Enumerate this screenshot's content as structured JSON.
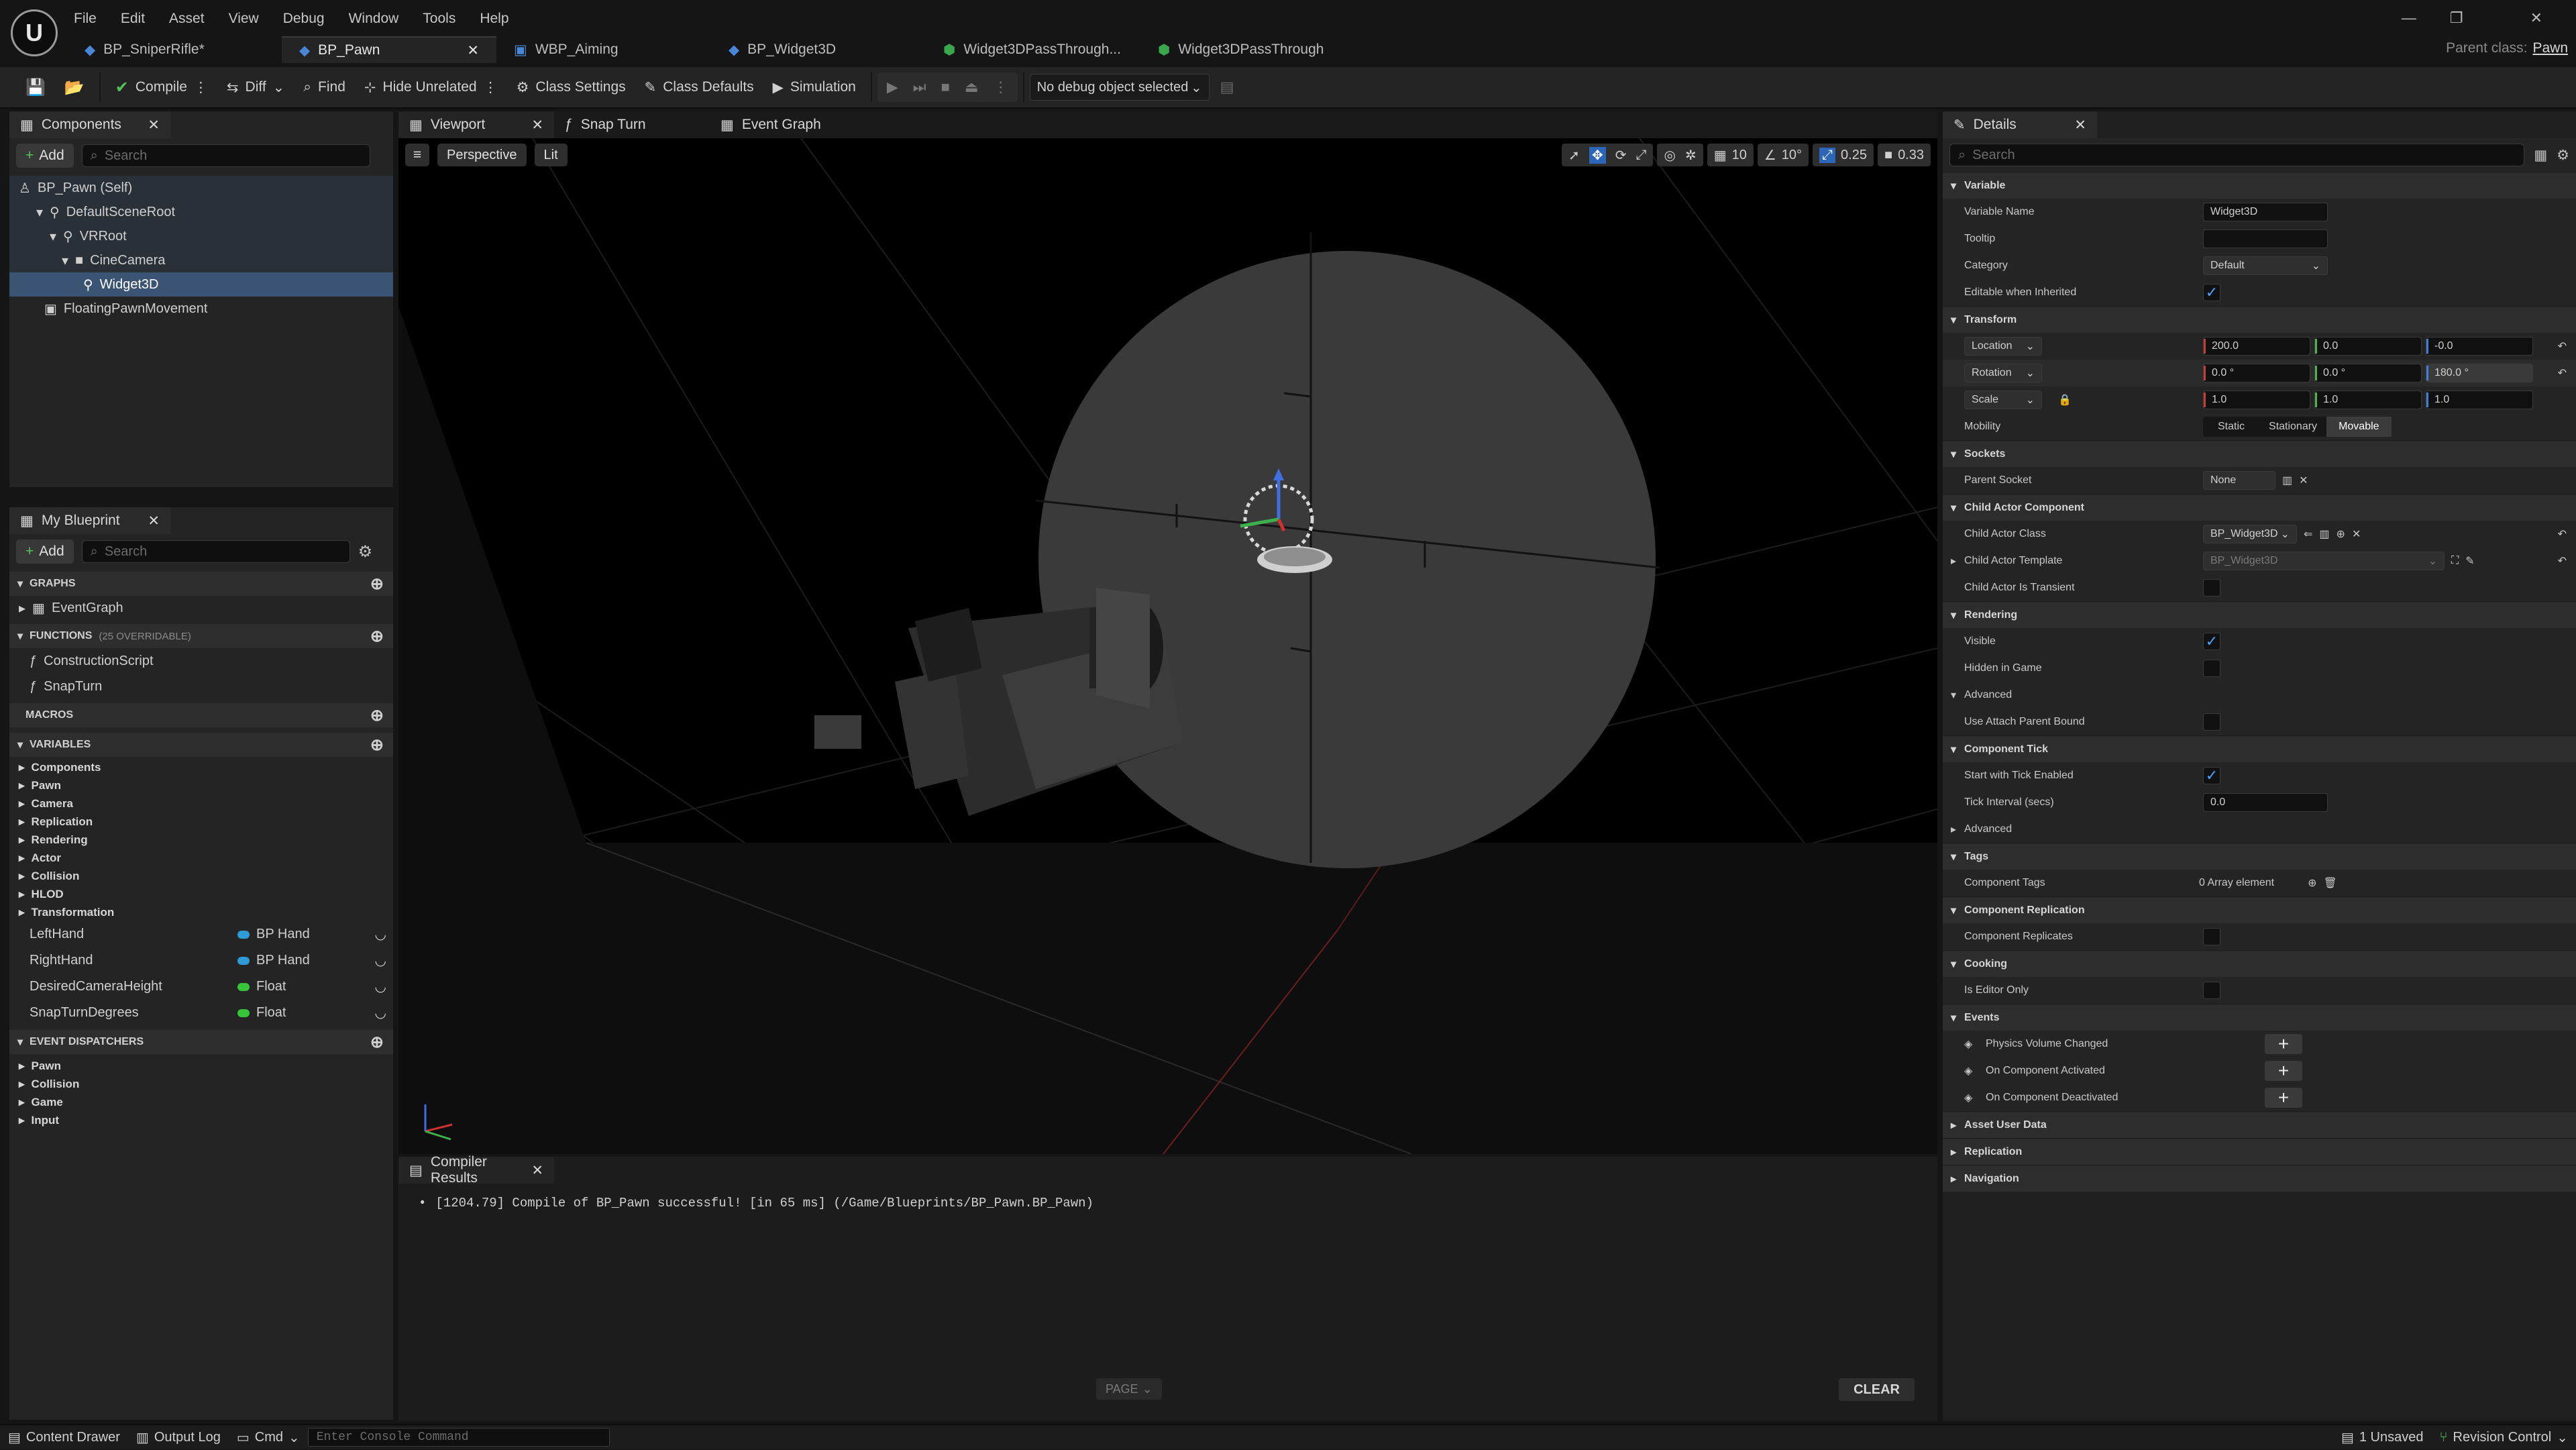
{
  "menu": [
    "File",
    "Edit",
    "Asset",
    "View",
    "Debug",
    "Window",
    "Tools",
    "Help"
  ],
  "doc_tabs": [
    {
      "label": "BP_SniperRifle*",
      "active": false
    },
    {
      "label": "BP_Pawn",
      "active": true
    },
    {
      "label": "WBP_Aiming",
      "active": false
    },
    {
      "label": "BP_Widget3D",
      "active": false
    },
    {
      "label": "Widget3DPassThrough...",
      "active": false
    },
    {
      "label": "Widget3DPassThrough",
      "active": false
    }
  ],
  "parent_class": {
    "label": "Parent class:",
    "value": "Pawn"
  },
  "toolbar": {
    "compile": "Compile",
    "diff": "Diff",
    "find": "Find",
    "hide_unrelated": "Hide Unrelated",
    "class_settings": "Class Settings",
    "class_defaults": "Class Defaults",
    "simulation": "Simulation",
    "debug_object": "No debug object selected"
  },
  "components": {
    "tab": "Components",
    "add": "Add",
    "search_placeholder": "Search",
    "items": [
      {
        "label": "BP_Pawn (Self)",
        "depth": 0
      },
      {
        "label": "DefaultSceneRoot",
        "depth": 1
      },
      {
        "label": "VRRoot",
        "depth": 2
      },
      {
        "label": "CineCamera",
        "depth": 3
      },
      {
        "label": "Widget3D",
        "depth": 4,
        "selected": true
      },
      {
        "label": "FloatingPawnMovement",
        "depth": 1
      }
    ]
  },
  "my_blueprint": {
    "tab": "My Blueprint",
    "add": "Add",
    "search_placeholder": "Search",
    "graphs_header": "GRAPHS",
    "graphs": [
      "EventGraph"
    ],
    "functions_header": "FUNCTIONS",
    "functions_note": "(25 OVERRIDABLE)",
    "functions": [
      "ConstructionScript",
      "SnapTurn"
    ],
    "macros_header": "MACROS",
    "variables_header": "VARIABLES",
    "variable_categories": [
      "Components",
      "Pawn",
      "Camera",
      "Replication",
      "Rendering",
      "Actor",
      "Collision",
      "HLOD",
      "Transformation"
    ],
    "variables": [
      {
        "name": "LeftHand",
        "type": "BP Hand",
        "color": "#2e9bd6"
      },
      {
        "name": "RightHand",
        "type": "BP Hand",
        "color": "#2e9bd6"
      },
      {
        "name": "DesiredCameraHeight",
        "type": "Float",
        "color": "#35c43a"
      },
      {
        "name": "SnapTurnDegrees",
        "type": "Float",
        "color": "#35c43a"
      }
    ],
    "dispatchers_header": "EVENT DISPATCHERS",
    "dispatcher_categories": [
      "Pawn",
      "Collision",
      "Game",
      "Input"
    ]
  },
  "viewport": {
    "tabs": [
      "Viewport",
      "Snap Turn",
      "Event Graph"
    ],
    "perspective": "Perspective",
    "lit": "Lit",
    "grid_snap": "10",
    "rot_snap": "10°",
    "scale_snap": "0.25",
    "cam_speed": "0.33"
  },
  "compiler": {
    "tab": "Compiler Results",
    "message": "[1204.79] Compile of BP_Pawn successful! [in 65 ms] (/Game/Blueprints/BP_Pawn.BP_Pawn)",
    "page": "PAGE",
    "clear": "CLEAR"
  },
  "details": {
    "tab": "Details",
    "search_placeholder": "Search",
    "variable": {
      "header": "Variable",
      "name_label": "Variable Name",
      "name_value": "Widget3D",
      "tooltip_label": "Tooltip",
      "category_label": "Category",
      "category_value": "Default",
      "editable_label": "Editable when Inherited"
    },
    "transform": {
      "header": "Transform",
      "location": "Location",
      "rotation": "Rotation",
      "scale": "Scale",
      "loc": [
        "200.0",
        "0.0",
        "-0.0"
      ],
      "rot": [
        "0.0 °",
        "0.0 °",
        "180.0 °"
      ],
      "scl": [
        "1.0",
        "1.0",
        "1.0"
      ],
      "mobility_label": "Mobility",
      "mobility": [
        "Static",
        "Stationary",
        "Movable"
      ]
    },
    "sockets": {
      "header": "Sockets",
      "parent_label": "Parent Socket",
      "parent_value": "None"
    },
    "child_actor": {
      "header": "Child Actor Component",
      "class_label": "Child Actor Class",
      "class_value": "BP_Widget3D",
      "template_label": "Child Actor Template",
      "template_value": "BP_Widget3D",
      "transient_label": "Child Actor Is Transient"
    },
    "rendering": {
      "header": "Rendering",
      "visible": "Visible",
      "hidden": "Hidden in Game",
      "advanced": "Advanced",
      "attach_parent": "Use Attach Parent Bound"
    },
    "tick": {
      "header": "Component Tick",
      "start": "Start with Tick Enabled",
      "interval": "Tick Interval (secs)",
      "interval_value": "0.0",
      "advanced": "Advanced"
    },
    "tags": {
      "header": "Tags",
      "label": "Component Tags",
      "value": "0 Array element"
    },
    "replication": {
      "header": "Component Replication",
      "label": "Component Replicates"
    },
    "cooking": {
      "header": "Cooking",
      "label": "Is Editor Only"
    },
    "events": {
      "header": "Events",
      "items": [
        "Physics Volume Changed",
        "On Component Activated",
        "On Component Deactivated"
      ]
    },
    "collapsed": [
      "Asset User Data",
      "Replication",
      "Navigation"
    ]
  },
  "status": {
    "content_drawer": "Content Drawer",
    "output_log": "Output Log",
    "cmd": "Cmd",
    "console_placeholder": "Enter Console Command",
    "unsaved": "1 Unsaved",
    "revision": "Revision Control"
  }
}
